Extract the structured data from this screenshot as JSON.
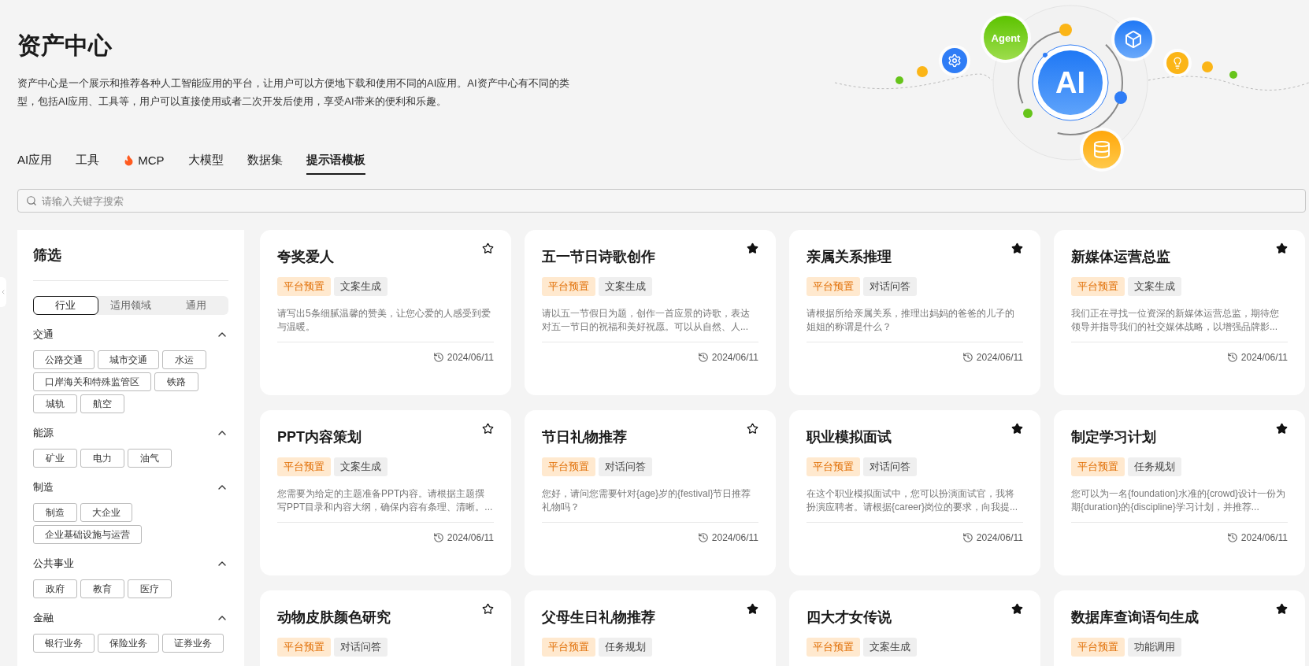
{
  "page": {
    "title": "资产中心",
    "description": "资产中心是一个展示和推荐各种人工智能应用的平台，让用户可以方便地下载和使用不同的AI应用。AI资产中心有不同的类型，包括AI应用、工具等，用户可以直接使用或者二次开发后使用，享受AI带来的便利和乐趣。"
  },
  "hero": {
    "agent_label": "Agent",
    "ai_label": "AI"
  },
  "tabs": [
    {
      "label": "AI应用",
      "selected": false,
      "hot": false
    },
    {
      "label": "工具",
      "selected": false,
      "hot": false
    },
    {
      "label": "MCP",
      "selected": false,
      "hot": true
    },
    {
      "label": "大模型",
      "selected": false,
      "hot": false
    },
    {
      "label": "数据集",
      "selected": false,
      "hot": false
    },
    {
      "label": "提示语模板",
      "selected": true,
      "hot": false
    }
  ],
  "search": {
    "placeholder": "请输入关键字搜索"
  },
  "sidebar": {
    "title": "筛选",
    "segments": [
      {
        "label": "行业",
        "selected": true
      },
      {
        "label": "适用领域",
        "selected": false
      },
      {
        "label": "通用",
        "selected": false
      }
    ],
    "groups": [
      {
        "title": "交通",
        "expanded": true,
        "tags": [
          "公路交通",
          "城市交通",
          "水运",
          "口岸海关和特殊监管区",
          "铁路",
          "城轨",
          "航空"
        ]
      },
      {
        "title": "能源",
        "expanded": true,
        "tags": [
          "矿业",
          "电力",
          "油气"
        ]
      },
      {
        "title": "制造",
        "expanded": true,
        "tags": [
          "制造",
          "大企业",
          "企业基础设施与运营"
        ]
      },
      {
        "title": "公共事业",
        "expanded": true,
        "tags": [
          "政府",
          "教育",
          "医疗"
        ]
      },
      {
        "title": "金融",
        "expanded": true,
        "tags": [
          "银行业务",
          "保险业务",
          "证券业务"
        ]
      }
    ]
  },
  "cards": [
    {
      "title": "夸奖爱人",
      "starred": false,
      "tags": [
        {
          "label": "平台预置",
          "kind": "source"
        },
        {
          "label": "文案生成",
          "kind": "category"
        }
      ],
      "description": "请写出5条细腻温馨的赞美，让您心爱的人感受到爱与温暖。",
      "date": "2024/06/11"
    },
    {
      "title": "五一节日诗歌创作",
      "starred": true,
      "tags": [
        {
          "label": "平台预置",
          "kind": "source"
        },
        {
          "label": "文案生成",
          "kind": "category"
        }
      ],
      "description": "请以五一节假日为题，创作一首应景的诗歌，表达对五一节日的祝福和美好祝愿。可以从自然、人...",
      "date": "2024/06/11"
    },
    {
      "title": "亲属关系推理",
      "starred": true,
      "tags": [
        {
          "label": "平台预置",
          "kind": "source"
        },
        {
          "label": "对话问答",
          "kind": "category"
        }
      ],
      "description": "请根据所给亲属关系，推理出妈妈的爸爸的儿子的姐姐的称谓是什么？",
      "date": "2024/06/11"
    },
    {
      "title": "新媒体运营总监",
      "starred": true,
      "tags": [
        {
          "label": "平台预置",
          "kind": "source"
        },
        {
          "label": "文案生成",
          "kind": "category"
        }
      ],
      "description": "我们正在寻找一位资深的新媒体运营总监，期待您领导并指导我们的社交媒体战略，以增强品牌影...",
      "date": "2024/06/11"
    },
    {
      "title": "PPT内容策划",
      "starred": false,
      "tags": [
        {
          "label": "平台预置",
          "kind": "source"
        },
        {
          "label": "文案生成",
          "kind": "category"
        }
      ],
      "description": "您需要为给定的主题准备PPT内容。请根据主题撰写PPT目录和内容大纲，确保内容有条理、清晰。...",
      "date": "2024/06/11"
    },
    {
      "title": "节日礼物推荐",
      "starred": false,
      "tags": [
        {
          "label": "平台预置",
          "kind": "source"
        },
        {
          "label": "对话问答",
          "kind": "category"
        }
      ],
      "description": "您好，请问您需要针对{age}岁的{festival}节日推荐礼物吗？",
      "date": "2024/06/11"
    },
    {
      "title": "职业模拟面试",
      "starred": true,
      "tags": [
        {
          "label": "平台预置",
          "kind": "source"
        },
        {
          "label": "对话问答",
          "kind": "category"
        }
      ],
      "description": "在这个职业模拟面试中，您可以扮演面试官，我将扮演应聘者。请根据{career}岗位的要求，向我提...",
      "date": "2024/06/11"
    },
    {
      "title": "制定学习计划",
      "starred": true,
      "tags": [
        {
          "label": "平台预置",
          "kind": "source"
        },
        {
          "label": "任务规划",
          "kind": "category"
        }
      ],
      "description": "您可以为一名{foundation}水准的{crowd}设计一份为期{duration}的{discipline}学习计划，并推荐...",
      "date": "2024/06/11"
    },
    {
      "title": "动物皮肤颜色研究",
      "starred": false,
      "tags": [
        {
          "label": "平台预置",
          "kind": "source"
        },
        {
          "label": "对话问答",
          "kind": "category"
        }
      ]
    },
    {
      "title": "父母生日礼物推荐",
      "starred": true,
      "tags": [
        {
          "label": "平台预置",
          "kind": "source"
        },
        {
          "label": "任务规划",
          "kind": "category"
        }
      ]
    },
    {
      "title": "四大才女传说",
      "starred": true,
      "tags": [
        {
          "label": "平台预置",
          "kind": "source"
        },
        {
          "label": "文案生成",
          "kind": "category"
        }
      ]
    },
    {
      "title": "数据库查询语句生成",
      "starred": true,
      "tags": [
        {
          "label": "平台预置",
          "kind": "source"
        },
        {
          "label": "功能调用",
          "kind": "category"
        }
      ]
    }
  ]
}
